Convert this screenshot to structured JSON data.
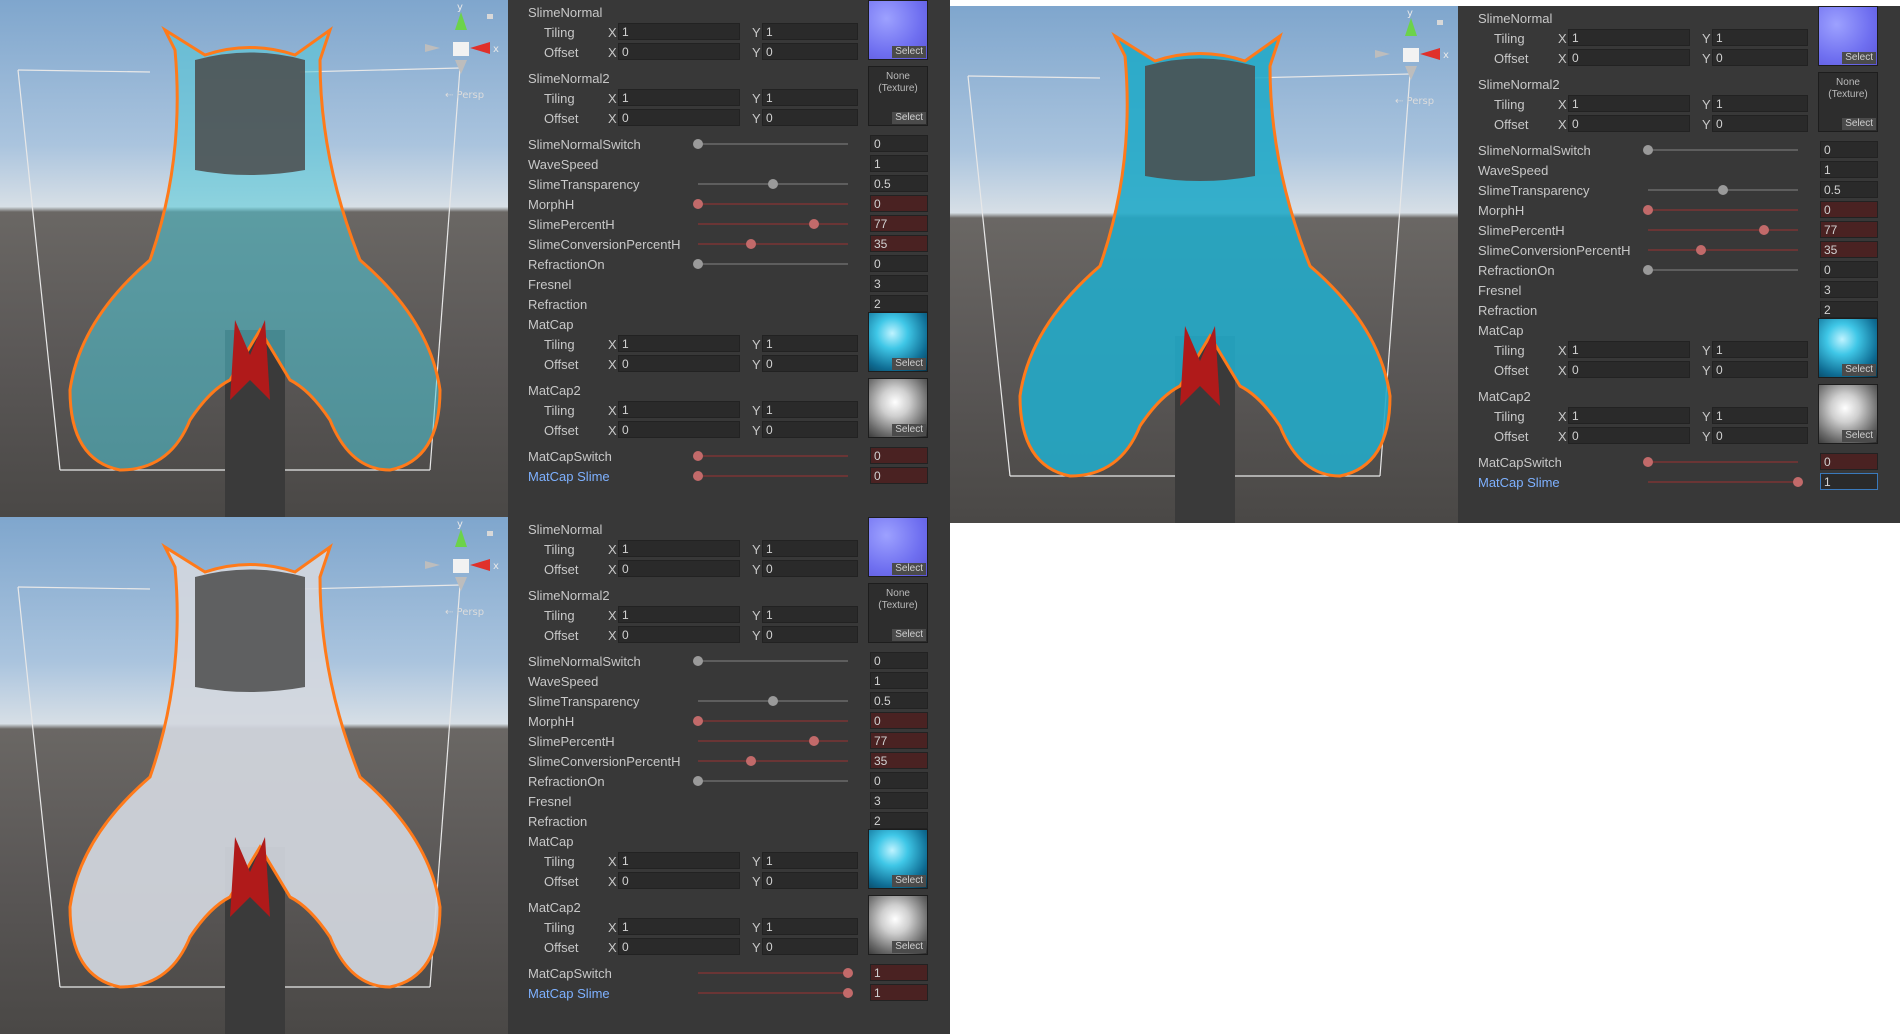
{
  "gizmo": {
    "y_label": "y",
    "x_label": "x",
    "persp_label": "Persp"
  },
  "variants": [
    {
      "matcap_switch_slider": 0.0,
      "matcap_slime_slider": 0.0,
      "props": {
        "slime_normal": "SlimeNormal",
        "slime_normal2": "SlimeNormal2",
        "tiling": "Tiling",
        "offset": "Offset",
        "x": "X",
        "y": "Y",
        "tiling_x": "1",
        "tiling_y": "1",
        "offset_x": "0",
        "offset_y": "0",
        "none_texture": "None\n(Texture)",
        "select": "Select",
        "normal_switch": "SlimeNormalSwitch",
        "normal_switch_value": "0",
        "wave_speed": "WaveSpeed",
        "wave_speed_value": "1",
        "transparency": "SlimeTransparency",
        "transparency_value": "0.5",
        "morph": "MorphH",
        "morph_value": "0",
        "percent": "SlimePercentH",
        "percent_value": "77",
        "conversion": "SlimeConversionPercentH",
        "conversion_value": "35",
        "refraction_on": "RefractionOn",
        "refraction_on_value": "0",
        "fresnel": "Fresnel",
        "fresnel_value": "3",
        "refraction": "Refraction",
        "refraction_value": "2",
        "matcap": "MatCap",
        "matcap2": "MatCap2",
        "matcap_switch": "MatCapSwitch",
        "matcap_switch_value": "0",
        "matcap_slime": "MatCap Slime",
        "matcap_slime_value": "0"
      }
    },
    {
      "matcap_switch_slider": 0.0,
      "matcap_slime_slider": 1.0,
      "props": {
        "slime_normal": "SlimeNormal",
        "slime_normal2": "SlimeNormal2",
        "tiling": "Tiling",
        "offset": "Offset",
        "x": "X",
        "y": "Y",
        "tiling_x": "1",
        "tiling_y": "1",
        "offset_x": "0",
        "offset_y": "0",
        "none_texture": "None\n(Texture)",
        "select": "Select",
        "normal_switch": "SlimeNormalSwitch",
        "normal_switch_value": "0",
        "wave_speed": "WaveSpeed",
        "wave_speed_value": "1",
        "transparency": "SlimeTransparency",
        "transparency_value": "0.5",
        "morph": "MorphH",
        "morph_value": "0",
        "percent": "SlimePercentH",
        "percent_value": "77",
        "conversion": "SlimeConversionPercentH",
        "conversion_value": "35",
        "refraction_on": "RefractionOn",
        "refraction_on_value": "0",
        "fresnel": "Fresnel",
        "fresnel_value": "3",
        "refraction": "Refraction",
        "refraction_value": "2",
        "matcap": "MatCap",
        "matcap2": "MatCap2",
        "matcap_switch": "MatCapSwitch",
        "matcap_switch_value": "0",
        "matcap_slime": "MatCap Slime",
        "matcap_slime_value": "1"
      }
    },
    {
      "matcap_switch_slider": 1.0,
      "matcap_slime_slider": 1.0,
      "props": {
        "slime_normal": "SlimeNormal",
        "slime_normal2": "SlimeNormal2",
        "tiling": "Tiling",
        "offset": "Offset",
        "x": "X",
        "y": "Y",
        "tiling_x": "1",
        "tiling_y": "1",
        "offset_x": "0",
        "offset_y": "0",
        "none_texture": "None\n(Texture)",
        "select": "Select",
        "normal_switch": "SlimeNormalSwitch",
        "normal_switch_value": "0",
        "wave_speed": "WaveSpeed",
        "wave_speed_value": "1",
        "transparency": "SlimeTransparency",
        "transparency_value": "0.5",
        "morph": "MorphH",
        "morph_value": "0",
        "percent": "SlimePercentH",
        "percent_value": "77",
        "conversion": "SlimeConversionPercentH",
        "conversion_value": "35",
        "refraction_on": "RefractionOn",
        "refraction_on_value": "0",
        "fresnel": "Fresnel",
        "fresnel_value": "3",
        "refraction": "Refraction",
        "refraction_value": "2",
        "matcap": "MatCap",
        "matcap2": "MatCap2",
        "matcap_switch": "MatCapSwitch",
        "matcap_switch_value": "1",
        "matcap_slime": "MatCap Slime",
        "matcap_slime_value": "1"
      }
    }
  ],
  "colors": {
    "inspector_bg": "#383838",
    "active_label": "#7eb1ff",
    "slime_cyan": "#37c3d6",
    "selection_orange": "#ff7a1a"
  }
}
